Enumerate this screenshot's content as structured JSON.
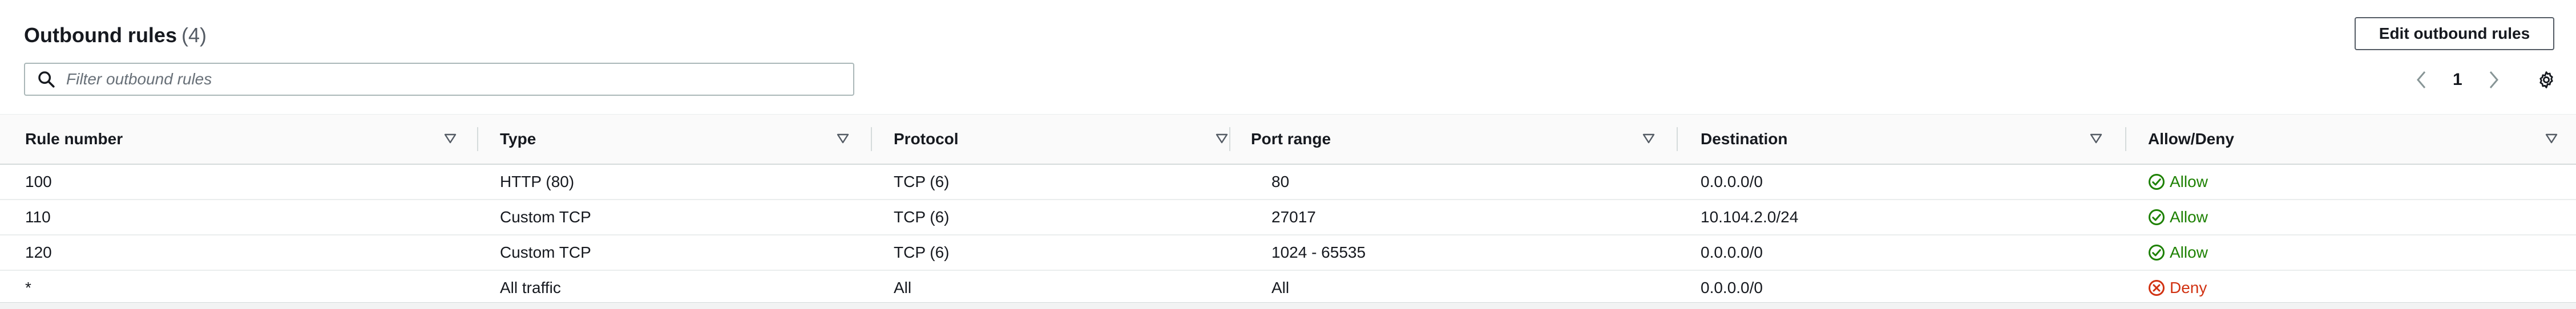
{
  "header": {
    "title": "Outbound rules",
    "count": "(4)",
    "edit_button_label": "Edit outbound rules"
  },
  "filter": {
    "placeholder": "Filter outbound rules",
    "value": ""
  },
  "pagination": {
    "current_page": "1"
  },
  "table": {
    "columns": [
      "Rule number",
      "Type",
      "Protocol",
      "Port range",
      "Destination",
      "Allow/Deny"
    ],
    "rows": [
      {
        "rule_number": "100",
        "type": "HTTP (80)",
        "protocol": "TCP (6)",
        "port_range": "80",
        "destination": "0.0.0.0/0",
        "action": "Allow"
      },
      {
        "rule_number": "110",
        "type": "Custom TCP",
        "protocol": "TCP (6)",
        "port_range": "27017",
        "destination": "10.104.2.0/24",
        "action": "Allow"
      },
      {
        "rule_number": "120",
        "type": "Custom TCP",
        "protocol": "TCP (6)",
        "port_range": "1024 - 65535",
        "destination": "0.0.0.0/0",
        "action": "Allow"
      },
      {
        "rule_number": "*",
        "type": "All traffic",
        "protocol": "All",
        "port_range": "All",
        "destination": "0.0.0.0/0",
        "action": "Deny"
      }
    ]
  },
  "icons": {
    "search": "search-icon",
    "prev": "chevron-left-icon",
    "next": "chevron-right-icon",
    "settings": "gear-icon",
    "sort": "sort-caret-icon",
    "allow": "check-circle-icon",
    "deny": "x-circle-icon"
  },
  "colors": {
    "allow": "#1d8102",
    "deny": "#d13212",
    "text": "#16191f",
    "border": "#d5dbdb"
  }
}
